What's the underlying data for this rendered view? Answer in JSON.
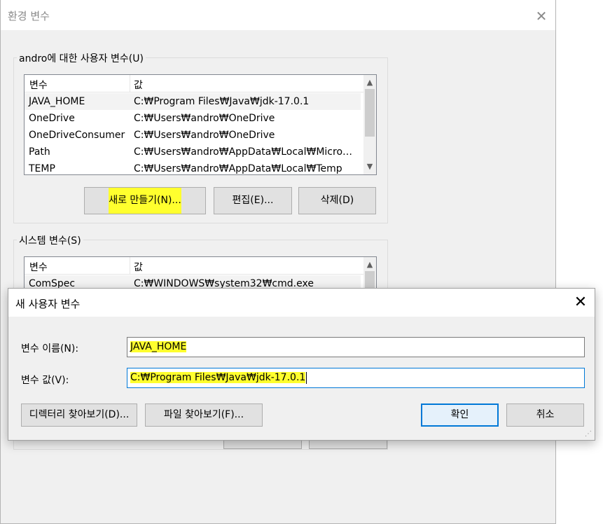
{
  "background_window": {
    "title": "환경 변수",
    "close_glyph": "✕",
    "user_vars": {
      "caption": "andro에 대한 사용자 변수(U)",
      "headers": [
        "변수",
        "값"
      ],
      "rows": [
        {
          "name": "JAVA_HOME",
          "value": "C:₩Program Files₩Java₩jdk-17.0.1"
        },
        {
          "name": "OneDrive",
          "value": "C:₩Users₩andro₩OneDrive"
        },
        {
          "name": "OneDriveConsumer",
          "value": "C:₩Users₩andro₩OneDrive"
        },
        {
          "name": "Path",
          "value": "C:₩Users₩andro₩AppData₩Local₩Microsoft..."
        },
        {
          "name": "TEMP",
          "value": "C:₩Users₩andro₩AppData₩Local₩Temp"
        }
      ],
      "buttons": {
        "new": "새로 만들기(N)...",
        "edit": "편집(E)...",
        "delete": "삭제(D)"
      }
    },
    "system_vars": {
      "caption": "시스템 변수(S)",
      "headers": [
        "변수",
        "값"
      ],
      "rows": [
        {
          "name": "ComSpec",
          "value": "C:₩WINDOWS₩system32₩cmd.exe"
        }
      ]
    }
  },
  "dialog": {
    "title": "새 사용자 변수",
    "close_glyph": "✕",
    "name_label": "변수 이름(N):",
    "name_value": "JAVA_HOME",
    "value_label": "변수 값(V):",
    "value_value": "C:₩Program Files₩Java₩jdk-17.0.1",
    "buttons": {
      "browse_dir": "디렉터리 찾아보기(D)...",
      "browse_file": "파일 찾아보기(F)...",
      "ok": "확인",
      "cancel": "취소"
    }
  },
  "colors": {
    "highlight": "#ffff2e",
    "focus_accent": "#0078d7"
  }
}
